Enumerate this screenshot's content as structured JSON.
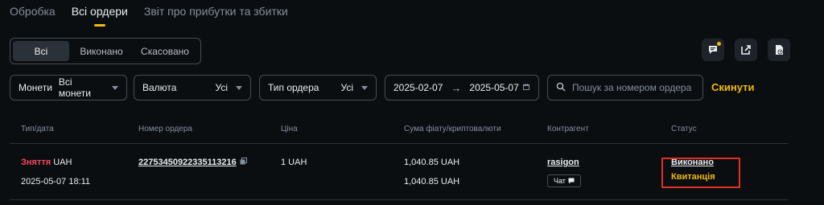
{
  "top_tabs": [
    {
      "label": "Обробка"
    },
    {
      "label": "Всі ордери"
    },
    {
      "label": "Звіт про прибутки та збитки"
    }
  ],
  "segmented": [
    "Всі",
    "Виконано",
    "Скасовано"
  ],
  "filters": {
    "coins": {
      "label": "Монети",
      "value": "Всі монети"
    },
    "currency": {
      "label": "Валюта",
      "value": "Усі"
    },
    "order_type": {
      "label": "Тип ордера",
      "value": "Усі"
    },
    "date_from": "2025-02-07",
    "date_to": "2025-05-07",
    "search_placeholder": "Пошук за номером ордера",
    "reset_label": "Скинути"
  },
  "table": {
    "headers": [
      "Тип/дата",
      "Номер ордера",
      "Ціна",
      "Сума фіату/криптовалюти",
      "Контрагент",
      "Статус"
    ],
    "row": {
      "side": "Зняття",
      "currency": "UAH",
      "datetime": "2025-05-07 18:11",
      "order_no": "22753450922335113216",
      "price": "1 UAH",
      "fiat_amount": "1,040.85 UAH",
      "crypto_amount": "1,040.85 UAH",
      "counterparty": "rasigon",
      "chat_label": "Чат",
      "status": "Виконано",
      "receipt": "Квитанція"
    }
  },
  "colors": {
    "accent": "#f0b90b",
    "sell": "#f6465d",
    "highlight": "#e03023"
  }
}
